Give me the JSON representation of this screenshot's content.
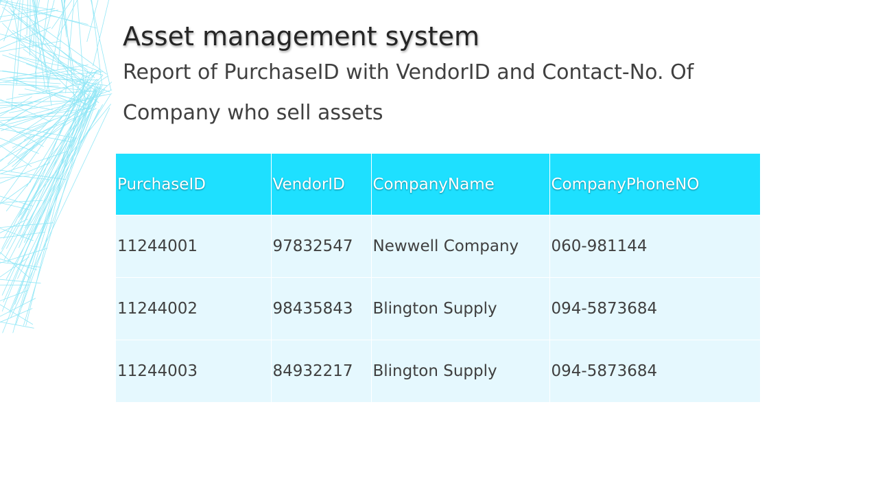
{
  "slide": {
    "title": "Asset management system",
    "subtitle": "Report of PurchaseID with VendorID and Contact-No. Of Company who sell assets"
  },
  "theme": {
    "header_color": "#1ee0ff",
    "row_color": "#e5f8fe",
    "decoration_color": "#7fe3f5"
  },
  "table": {
    "headers": [
      "PurchaseID",
      "VendorID",
      "CompanyName",
      "CompanyPhoneNO"
    ],
    "rows": [
      [
        "11244001",
        "97832547",
        "Newwell Company",
        "060-981144"
      ],
      [
        "11244002",
        "98435843",
        "Blington Supply",
        "094-5873684"
      ],
      [
        "11244003",
        "84932217",
        "Blington Supply",
        "094-5873684"
      ]
    ]
  }
}
